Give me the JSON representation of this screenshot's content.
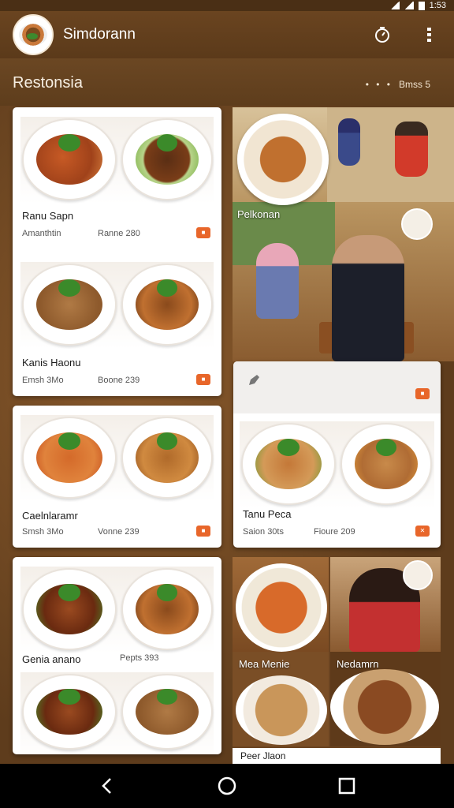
{
  "status": {
    "time": "1:53"
  },
  "app": {
    "title": "Simdorann"
  },
  "section": {
    "title": "Restonsia",
    "meta_dots": "• • •",
    "meta_text": "Bmss 5"
  },
  "cards": [
    {
      "name": "Ranu Sapn",
      "sub": "Amanthtin",
      "price": "Ranne 280",
      "badge": "■"
    },
    {
      "name": "Kanis Haonu",
      "sub": "Emsh 3Mo",
      "price": "Boone 239",
      "badge": "■"
    },
    {
      "name": "Caelnlaramr",
      "sub": "Smsh 3Mo",
      "price": "Vonne 239",
      "badge": "■"
    },
    {
      "name": "Tanu Peca",
      "sub": "Saion 30ts",
      "price": "Fioure 209",
      "badge": "✕"
    },
    {
      "name": "Genia anano",
      "sub": "",
      "price": "Pepts 393",
      "badge": ""
    }
  ],
  "photos": {
    "restaurant_label": "Pelkonan",
    "bottom_left_label": "Mea Menie",
    "bottom_right_label": "Nedamrn",
    "bottom_caption": "Peer Jlaon"
  },
  "colors": {
    "accent": "#e8662a",
    "bar": "#5b3a1a"
  }
}
